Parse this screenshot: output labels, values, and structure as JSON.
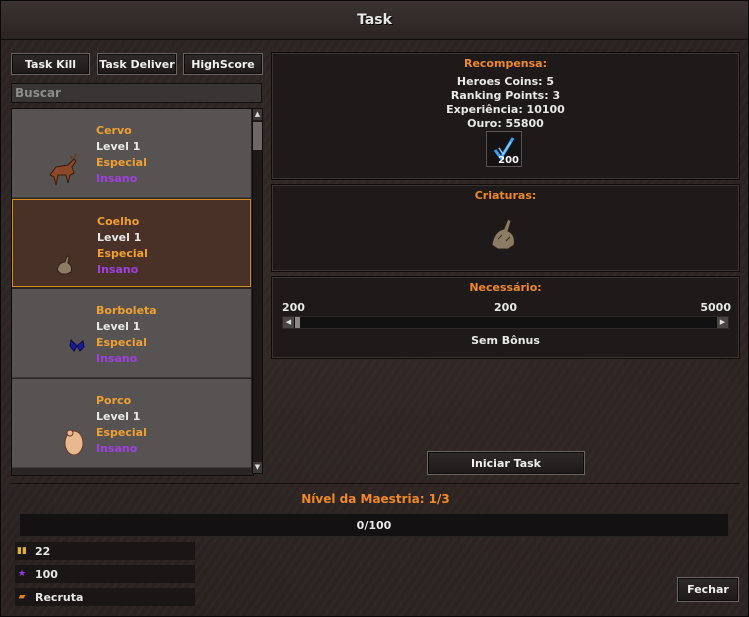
{
  "window": {
    "title": "Task"
  },
  "tabs": {
    "task_kill": "Task Kill",
    "task_deliver": "Task Deliver",
    "highscore": "HighScore"
  },
  "search": {
    "placeholder": "Buscar"
  },
  "creatures": [
    {
      "name": "Cervo",
      "level": "Level 1",
      "especial": "Especial",
      "insano": "Insano"
    },
    {
      "name": "Coelho",
      "level": "Level 1",
      "especial": "Especial",
      "insano": "Insano"
    },
    {
      "name": "Borboleta",
      "level": "Level 1",
      "especial": "Especial",
      "insano": "Insano"
    },
    {
      "name": "Porco",
      "level": "Level 1",
      "especial": "Especial",
      "insano": "Insano"
    }
  ],
  "reward": {
    "header": "Recompensa:",
    "heroes_coins": "Heroes Coins: 5",
    "ranking_points": "Ranking Points: 3",
    "experiencia": "Experiência: 10100",
    "ouro": "Ouro: 55800",
    "item_count": "200",
    "item_icon": "blue-arrows-icon"
  },
  "criaturas": {
    "header": "Criaturas:",
    "icon": "rabbit-creature-icon"
  },
  "necessario": {
    "header": "Necessário:",
    "min": "200",
    "current": "200",
    "max": "5000",
    "bonus": "Sem Bônus",
    "slider_fraction": 0.0
  },
  "buttons": {
    "start": "Iniciar Task",
    "close": "Fechar"
  },
  "mastery": {
    "label": "Nível da Maestria: 1/3",
    "progress": "0/100",
    "fraction": 0.0
  },
  "stats": [
    {
      "icon": "coins-icon",
      "value": "22"
    },
    {
      "icon": "purple-star-icon",
      "value": "100"
    },
    {
      "icon": "rank-badge-icon",
      "value": "Recruta"
    }
  ],
  "colors": {
    "accent_orange": "#f08828",
    "insano_purple": "#a040e0",
    "selected_border": "#d88a1c"
  }
}
